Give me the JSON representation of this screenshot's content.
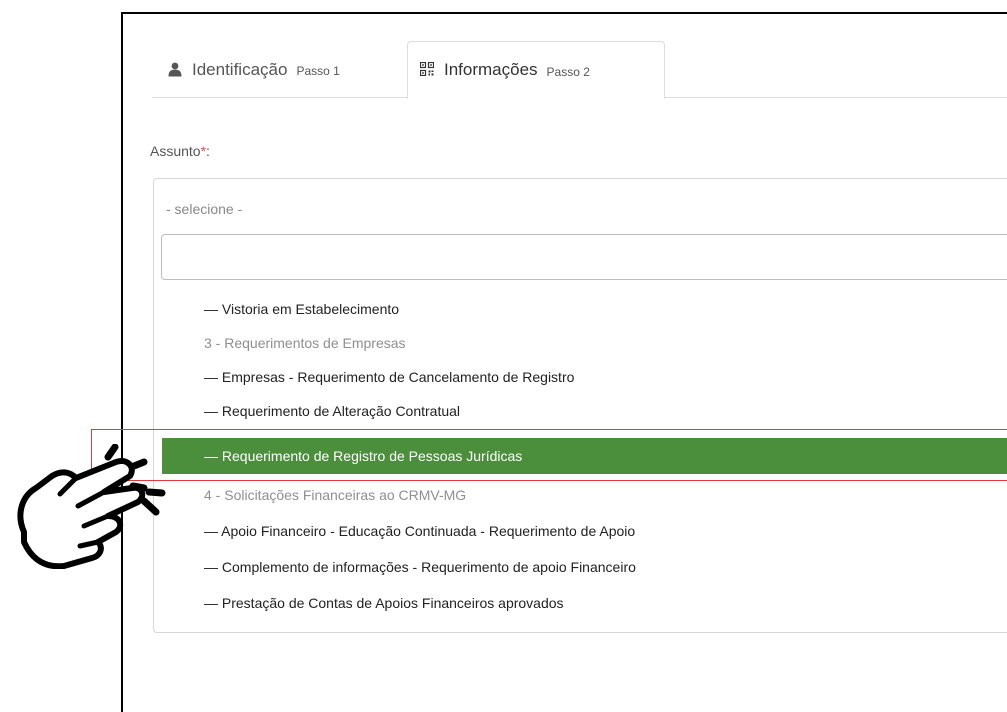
{
  "tabs": [
    {
      "label": "Identificação",
      "step": "Passo 1",
      "icon": "user-icon"
    },
    {
      "label": "Informações",
      "step": "Passo 2",
      "icon": "qrcode-icon",
      "active": true
    }
  ],
  "form": {
    "subject_label": "Assunto",
    "required_mark": "*",
    "label_suffix": ":",
    "select_placeholder": "- selecione -",
    "search_value": ""
  },
  "options": [
    {
      "text": "— Vistoria em Estabelecimento",
      "type": "item"
    },
    {
      "text": "3 - Requerimentos de Empresas",
      "type": "group"
    },
    {
      "text": "— Empresas - Requerimento de Cancelamento de Registro",
      "type": "item"
    },
    {
      "text": "— Requerimento de Alteração Contratual",
      "type": "item"
    },
    {
      "text": "— Requerimento de Registro de Pessoas Jurídicas",
      "type": "item",
      "selected": true
    },
    {
      "text": "4 - Solicitações Financeiras ao CRMV-MG",
      "type": "group"
    },
    {
      "text": "— Apoio Financeiro - Educação Continuada - Requerimento de Apoio",
      "type": "item"
    },
    {
      "text": "— Complemento de informações - Requerimento de apoio Financeiro",
      "type": "item"
    },
    {
      "text": "— Prestação de Contas de Apoios Financeiros aprovados",
      "type": "item"
    }
  ],
  "colors": {
    "selected_bg": "#4b8f3c",
    "highlight_border": "#e0393e",
    "required": "#d9534f"
  },
  "annotation": {
    "icon": "pointing-hand-icon"
  }
}
